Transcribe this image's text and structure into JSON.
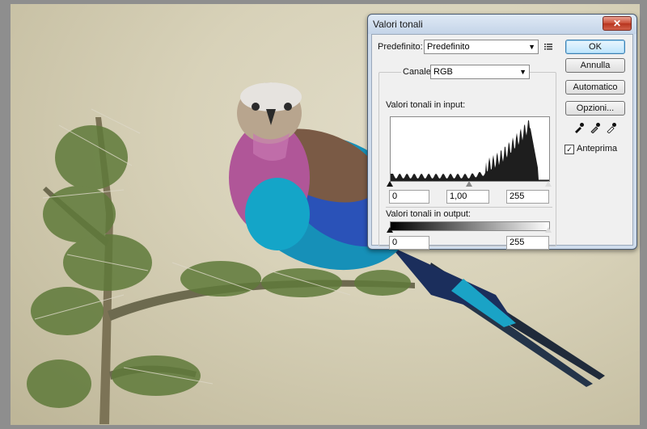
{
  "dialog": {
    "title": "Valori tonali",
    "close_glyph": "✕",
    "preset_label": "Predefinito:",
    "preset_value": "Predefinito",
    "channel_label": "Canale:",
    "channel_value": "RGB",
    "input_label": "Valori tonali in input:",
    "input_black": "0",
    "input_gamma": "1,00",
    "input_white": "255",
    "output_label": "Valori tonali in output:",
    "output_black": "0",
    "output_white": "255",
    "buttons": {
      "ok": "OK",
      "cancel": "Annulla",
      "auto": "Automatico",
      "options": "Opzioni..."
    },
    "preview_label": "Anteprima",
    "preview_checked": true
  },
  "colors": {
    "histogram": "#1e1e1e",
    "dialog_frame": "#cfdcec",
    "close_button": "#c94c34"
  }
}
